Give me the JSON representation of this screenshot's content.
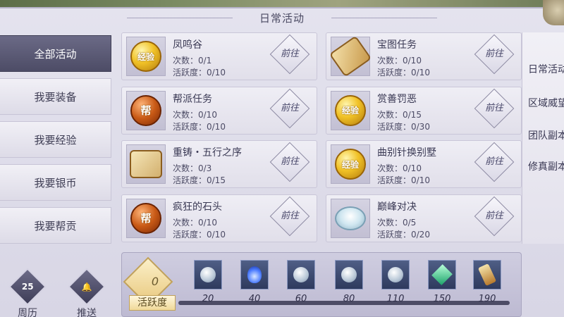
{
  "title": "日常活动",
  "sidebar": {
    "items": [
      {
        "label": "全部活动",
        "active": true
      },
      {
        "label": "我要装备"
      },
      {
        "label": "我要经验"
      },
      {
        "label": "我要银币"
      },
      {
        "label": "我要帮贡"
      }
    ]
  },
  "bottom_icons": [
    {
      "label": "周历",
      "icon": "calendar-icon",
      "glyph": "25"
    },
    {
      "label": "推送",
      "icon": "bell-icon",
      "glyph": "🔔"
    }
  ],
  "go_label": "前往",
  "cards": [
    {
      "name": "凤鸣谷",
      "count": "次数：0/1",
      "activity": "活跃度：0/10",
      "icon": "exp-coin-icon",
      "icon_text": "经验"
    },
    {
      "name": "宝图任务",
      "count": "次数：0/10",
      "activity": "活跃度：0/10",
      "icon": "scroll-icon"
    },
    {
      "name": "帮派任务",
      "count": "次数：0/10",
      "activity": "活跃度：0/10",
      "icon": "guild-coin-icon",
      "icon_text": "帮"
    },
    {
      "name": "赏善罚恶",
      "count": "次数：0/15",
      "activity": "活跃度：0/30",
      "icon": "exp-coin-icon",
      "icon_text": "经验"
    },
    {
      "name": "重铸・五行之序",
      "count": "次数：0/3",
      "activity": "活跃度：0/15",
      "icon": "treasure-map-icon"
    },
    {
      "name": "曲别针换别墅",
      "count": "次数：0/10",
      "activity": "活跃度：0/10",
      "icon": "exp-coin-icon",
      "icon_text": "经验"
    },
    {
      "name": "疯狂的石头",
      "count": "次数：0/10",
      "activity": "活跃度：0/10",
      "icon": "guild-coin-icon",
      "icon_text": "帮"
    },
    {
      "name": "巅峰对决",
      "count": "次数：0/5",
      "activity": "活跃度：0/20",
      "icon": "ring-icon"
    }
  ],
  "right_panel": {
    "items": [
      "日常活动",
      "区域威望",
      "团队副本",
      "修真副本"
    ]
  },
  "progress": {
    "value": "0",
    "label": "活跃度",
    "milestones": [
      {
        "num": "20",
        "icon": "silver-coin-icon"
      },
      {
        "num": "40",
        "icon": "blue-flame-icon"
      },
      {
        "num": "60",
        "icon": "silver-coin-icon"
      },
      {
        "num": "80",
        "icon": "crystal-ring-icon"
      },
      {
        "num": "110",
        "icon": "silver-coin-icon"
      },
      {
        "num": "150",
        "icon": "green-gem-icon"
      },
      {
        "num": "190",
        "icon": "scroll-icon"
      }
    ]
  }
}
